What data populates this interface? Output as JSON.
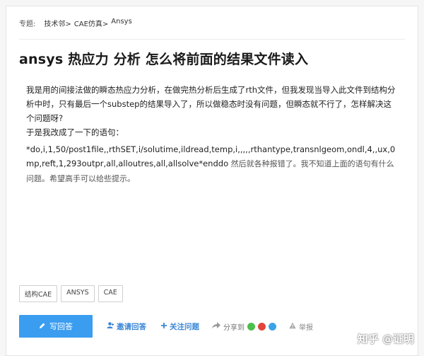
{
  "breadcrumb": {
    "topic_label": "专题:",
    "items": [
      "技术邻>",
      "CAE仿真>",
      "Ansys"
    ]
  },
  "question": {
    "title": "ansys 热应力 分析 怎么将前面的结果文件读入",
    "paragraph1": "我是用的间接法做的瞬态热应力分析，在做完热分析后生成了rth文件，但我发现当导入此文件到结构分析中时，只有最后一个substep的结果导入了，所以做稳态时没有问题，但瞬态就不行了，怎样解决这个问题呀?",
    "paragraph2": "于是我改成了一下的语句：",
    "code": "*do,i,1,50/post1file,,rthSET,i/solutime,ildread,temp,i,,,,,rthantype,transnlgeom,ondl,4,,ux,0mp,reft,1,293outpr,all,alloutres,all,allsolve*enddo",
    "tail": " 然后就各种报错了。我不知道上面的语句有什么问题。希望高手可以给些提示。"
  },
  "tags": [
    "结构CAE",
    "ANSYS",
    "CAE"
  ],
  "actions": {
    "answer_label": "写回答",
    "invite_label": "邀请回答",
    "follow_label": "关注问题",
    "share_label": "分享到",
    "report_label": "举报"
  },
  "watermark": "知乎 @证明",
  "colors": {
    "accent": "#3a9df0",
    "link": "#3a86d6",
    "wechat": "#4cbf4c",
    "weibo": "#e0463c",
    "qq": "#3ba3e8"
  }
}
